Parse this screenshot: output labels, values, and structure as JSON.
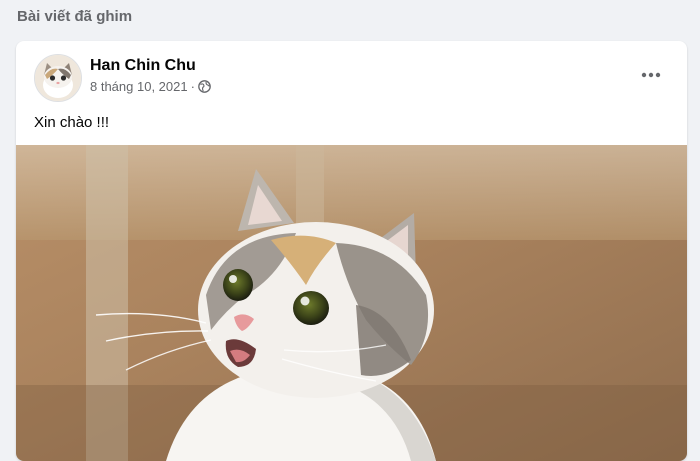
{
  "section": {
    "title": "Bài viết đã ghim"
  },
  "post": {
    "author": "Han Chin Chu",
    "date": "8 tháng 10, 2021",
    "separator": "·",
    "privacy_icon": "globe-icon",
    "text": "Xin chào !!!",
    "more_icon": "more-horizontal-icon",
    "image_subject": "cat-photo"
  },
  "colors": {
    "page_bg": "#f0f2f5",
    "card_bg": "#ffffff",
    "secondary_text": "#65676b",
    "primary_text": "#050505"
  }
}
